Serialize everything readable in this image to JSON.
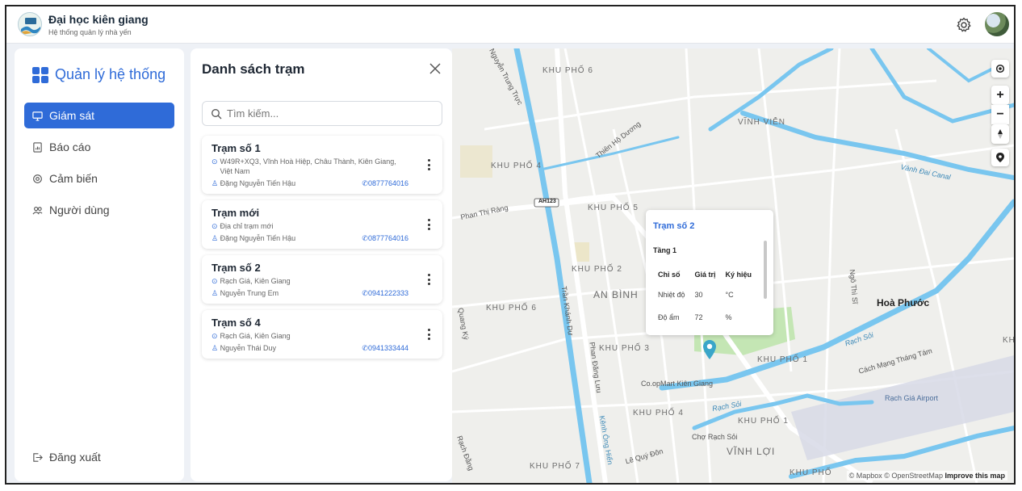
{
  "header": {
    "title": "Đại học kiên giang",
    "subtitle": "Hệ thống quản lý nhà yến"
  },
  "sidebar": {
    "brand": "Quản lý hệ thống",
    "items": [
      {
        "label": "Giám sát",
        "icon": "monitor-icon",
        "active": true
      },
      {
        "label": "Báo cáo",
        "icon": "report-icon",
        "active": false
      },
      {
        "label": "Cảm biến",
        "icon": "sensor-icon",
        "active": false
      },
      {
        "label": "Người dùng",
        "icon": "users-icon",
        "active": false
      }
    ],
    "logout": "Đăng xuất"
  },
  "panel": {
    "title": "Danh sách trạm",
    "search_placeholder": "Tìm kiếm...",
    "stations": [
      {
        "name": "Trạm số 1",
        "address": "W49R+XQ3, Vĩnh Hoà Hiệp, Châu Thành, Kiên Giang, Việt Nam",
        "owner": "Đặng Nguyễn Tiến Hậu",
        "phone": "0877764016"
      },
      {
        "name": "Trạm mới",
        "address": "Địa chỉ trạm mới",
        "owner": "Đặng Nguyễn Tiến Hậu",
        "phone": "0877764016"
      },
      {
        "name": "Trạm số 2",
        "address": "Rạch Giá, Kiên Giang",
        "owner": "Nguyễn Trung Em",
        "phone": "0941222333"
      },
      {
        "name": "Trạm số 4",
        "address": "Rạch Giá, Kiên Giang",
        "owner": "Nguyễn Thái Duy",
        "phone": "0941333444"
      }
    ]
  },
  "map": {
    "popup": {
      "title": "Trạm số 2",
      "floor": "Tầng 1",
      "headers": [
        "Chỉ số",
        "Giá trị",
        "Ký hiệu"
      ],
      "rows": [
        [
          "Nhiệt độ",
          "30",
          "°C"
        ],
        [
          "Độ ẩm",
          "72",
          "%"
        ]
      ]
    },
    "labels": {
      "kp6_top": "KHU PHỐ 6",
      "kp4_a": "KHU PHỐ 4",
      "kp5": "KHU PHỐ 5",
      "kp2": "KHU PHỐ 2",
      "an_binh": "AN BÌNH",
      "kp6_mid": "KHU PHỐ 6",
      "kp3": "KHU PHỐ 3",
      "kp1_a": "KHU PHỐ 1",
      "kp4_b": "KHU PHỐ 4",
      "kp1_b": "KHU PHỐ 1",
      "kp7": "KHU PHỐ 7",
      "vinh_vien": "VĨNH VIỄN",
      "vinh_loi": "VĨNH LỢI",
      "hoa_phuoc": "Hoà Phước",
      "kp_bottom": "KHU PHỐ",
      "kh_edge": "KH",
      "vanh_dai": "Vành Đai Canal",
      "rach_soi": "Rạch Sỏi",
      "rach_soi2": "Rạch Sỏi",
      "cmtt": "Cách Mạng Tháng Tám",
      "airport": "Rạch Giá Airport",
      "coopmart": "Co.opMart Kiên Giang",
      "cho": "Chợ Rạch Sỏi",
      "nguyen_trung_truc": "Nguyễn Trung Trực",
      "thien_ho_duong": "Thiên Hộ Dương",
      "phan_thi_rang": "Phan Thị Ràng",
      "ah123": "AH123",
      "tran_khanh_du": "Trần Khánh Dư",
      "phan_dang_luu": "Phan Đăng Lưu",
      "ngo_thi_si": "Ngô Thì Sĩ",
      "le_quy_don": "Lê Quý Đôn",
      "kenh_ong_hien": "Kênh Ông Hiển",
      "quang_ky": "Quang Ký",
      "rach_dang": "Rạch Đằng"
    },
    "attribution": "© Mapbox © OpenStreetMap",
    "improve": "Improve this map",
    "zoom_in": "+",
    "zoom_out": "−"
  },
  "colors": {
    "accent": "#2f6bd8",
    "water": "#79c6ef",
    "park": "#b9e3a6",
    "marker": "#3aa6c9"
  }
}
